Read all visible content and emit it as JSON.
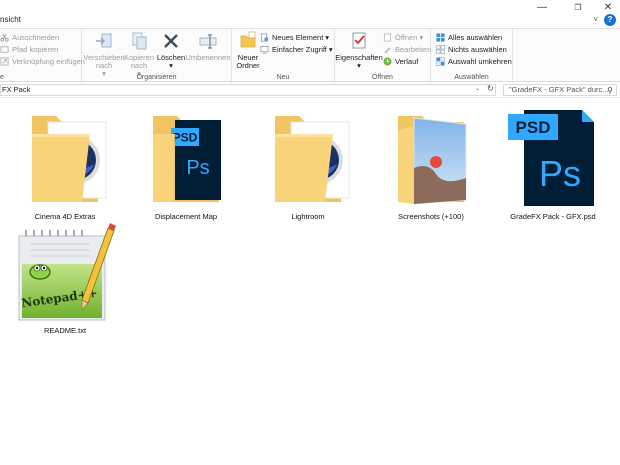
{
  "window": {
    "tab_partial": "nsicht",
    "minimize_glyph": "—",
    "restore_glyph": "❐",
    "close_glyph": "✕",
    "chevron_glyph": "˅",
    "help_glyph": "?"
  },
  "ribbon": {
    "clipboard": {
      "cut": "Ausschneiden",
      "copy_path": "Pfad kopieren",
      "paste_shortcut": "Verknüpfung einfügen",
      "group_partial": "e"
    },
    "organize": {
      "move_to": "Verschieben nach",
      "copy_to": "Kopieren nach",
      "delete": "Löschen",
      "rename": "Umbenennen",
      "group": "Organisieren"
    },
    "new": {
      "new_folder": "Neuer Ordner",
      "new_item": "Neues Element",
      "easy_access": "Einfacher Zugriff",
      "group": "Neu"
    },
    "open": {
      "properties": "Eigenschaften",
      "open": "Öffnen",
      "edit": "Bearbeiten",
      "history": "Verlauf",
      "group": "Öffnen"
    },
    "select": {
      "select_all": "Alles auswählen",
      "select_none": "Nichts auswählen",
      "invert": "Auswahl umkehren",
      "group": "Auswählen"
    }
  },
  "address": {
    "path": "FX Pack",
    "search_placeholder": "\"GradeFX - GFX Pack\" durc...",
    "refresh_glyph": "↻",
    "dropdown_glyph": "⌄",
    "search_glyph": "⚲"
  },
  "files": [
    {
      "name": "Cinema 4D Extras",
      "type": "folder-c4d"
    },
    {
      "name": "Displacement Map",
      "type": "folder-psd"
    },
    {
      "name": "Lightroom",
      "type": "folder-c4d"
    },
    {
      "name": "Screenshots (+100)",
      "type": "folder-photos"
    },
    {
      "name": "GradeFX Pack - GFX.psd",
      "type": "psd-file"
    },
    {
      "name": "README.txt",
      "type": "notepad-file"
    }
  ],
  "icon_text": {
    "psd": "PSD",
    "ps": "Ps",
    "notepad": "Notepad++"
  },
  "colors": {
    "folder": "#f7d37a",
    "ps_dark": "#001e36",
    "ps_blue": "#31a8ff",
    "c4d_blue": "#2b4ea8"
  }
}
